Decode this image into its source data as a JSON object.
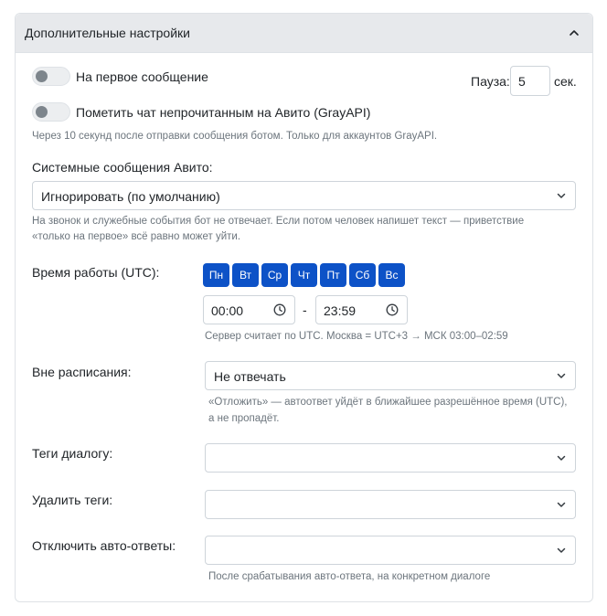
{
  "header": {
    "title": "Дополнительные настройки"
  },
  "first_message": {
    "label": "На первое сообщение",
    "enabled": false
  },
  "pause": {
    "label": "Пауза:",
    "value": "5",
    "unit": "сек."
  },
  "mark_unread": {
    "label": "Пометить чат непрочитанным на Авито (GrayAPI)",
    "enabled": false,
    "help": "Через 10 секунд после отправки сообщения ботом. Только для аккаунтов GrayAPI."
  },
  "system_messages": {
    "label": "Системные сообщения Авито:",
    "selected": "Игнорировать (по умолчанию)",
    "help_line1": "На звонок и служебные события бот не отвечает. Если потом человек напишет текст — приветствие",
    "help_line2": "«только на первое» всё равно может уйти."
  },
  "work_time": {
    "label": "Время работы (UTC):",
    "days": [
      "Пн",
      "Вт",
      "Ср",
      "Чт",
      "Пт",
      "Сб",
      "Вс"
    ],
    "from": "00:00",
    "separator": "-",
    "to": "23:59",
    "help": "Сервер считает по UTC. Москва = UTC+3 → МСК 03:00–02:59"
  },
  "off_schedule": {
    "label": "Вне расписания:",
    "selected": "Не отвечать",
    "help_line1": "«Отложить» — автоответ уйдёт в ближайшее разрешённое время (UTC),",
    "help_line2": "а не пропадёт."
  },
  "dialog_tags": {
    "label": "Теги диалогу:",
    "selected": ""
  },
  "remove_tags": {
    "label": "Удалить теги:",
    "selected": ""
  },
  "disable_autoreplies": {
    "label": "Отключить авто-ответы:",
    "selected": "",
    "help": "После срабатывания авто-ответа, на конкретном диалоге"
  },
  "colors": {
    "accent": "#0d52c7",
    "header_bg": "#e7e9ec",
    "help_text": "#6c757d"
  }
}
